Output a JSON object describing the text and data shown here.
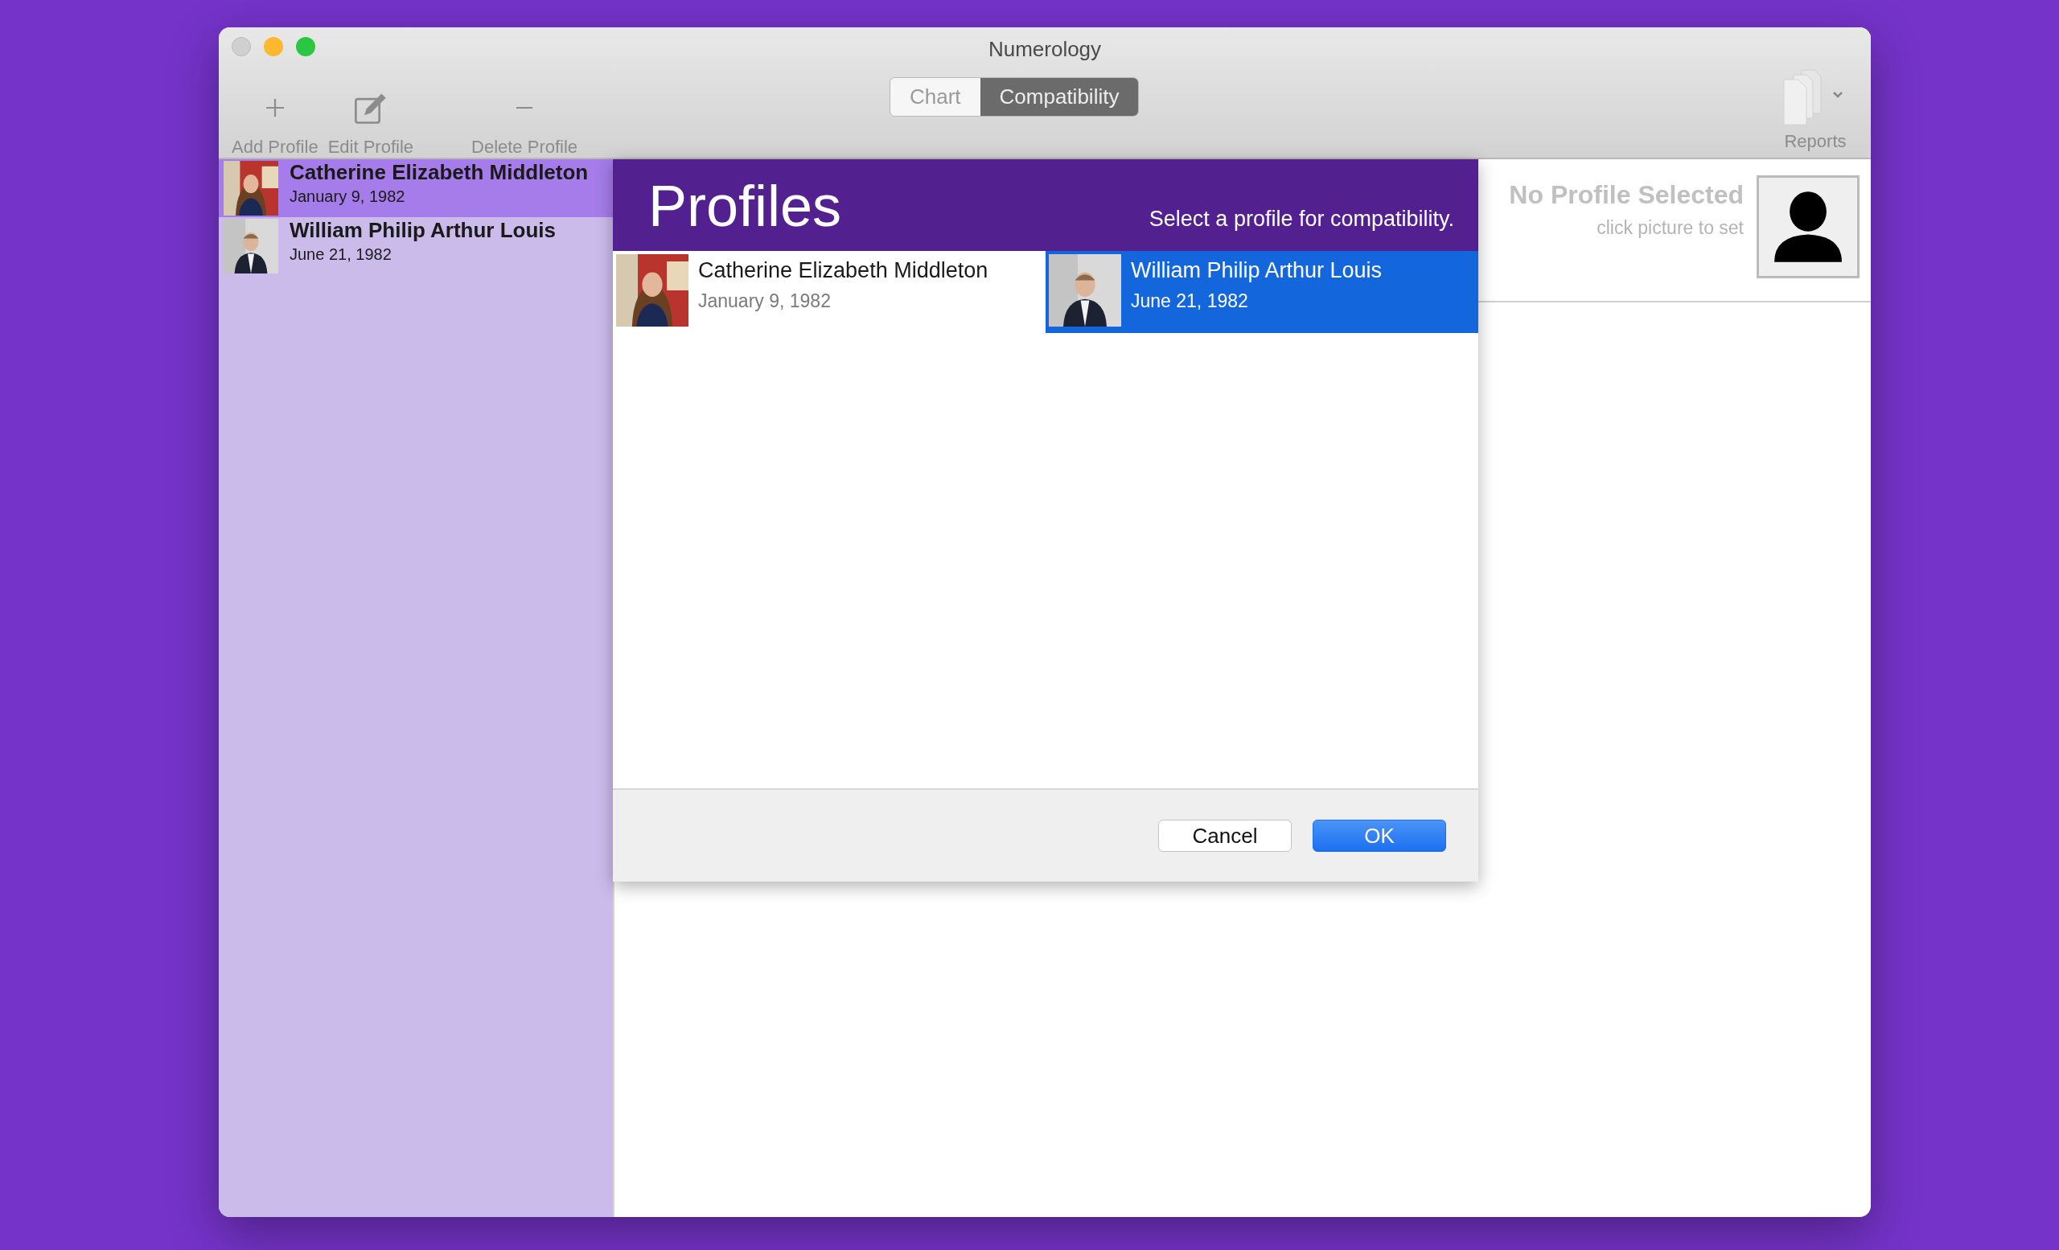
{
  "window": {
    "title": "Numerology"
  },
  "toolbar": {
    "buttons": [
      {
        "label": "Add Profile",
        "kind": "add"
      },
      {
        "label": "Edit Profile",
        "kind": "edit"
      },
      {
        "label": "Delete Profile",
        "kind": "delete"
      }
    ],
    "segments": [
      {
        "label": "Chart",
        "selected": false
      },
      {
        "label": "Compatibility",
        "selected": true
      }
    ],
    "reports": {
      "label": "Reports"
    }
  },
  "sidebar": {
    "items": [
      {
        "name": "Catherine Elizabeth Middleton",
        "date": "January 9, 1982",
        "selected": true
      },
      {
        "name": "William Philip Arthur Louis",
        "date": "June 21, 1982",
        "selected": false
      }
    ]
  },
  "detail": {
    "title": "No Profile Selected",
    "hint": "click picture to set"
  },
  "dialog": {
    "title": "Profiles",
    "subtitle": "Select a profile for compatibility.",
    "profiles": [
      {
        "name": "Catherine Elizabeth Middleton",
        "date": "January 9, 1982",
        "selected": false
      },
      {
        "name": "William Philip Arthur Louis",
        "date": "June 21, 1982",
        "selected": true
      }
    ],
    "buttons": [
      {
        "label": "Cancel",
        "kind": "cancel"
      },
      {
        "label": "OK",
        "kind": "ok"
      }
    ]
  }
}
